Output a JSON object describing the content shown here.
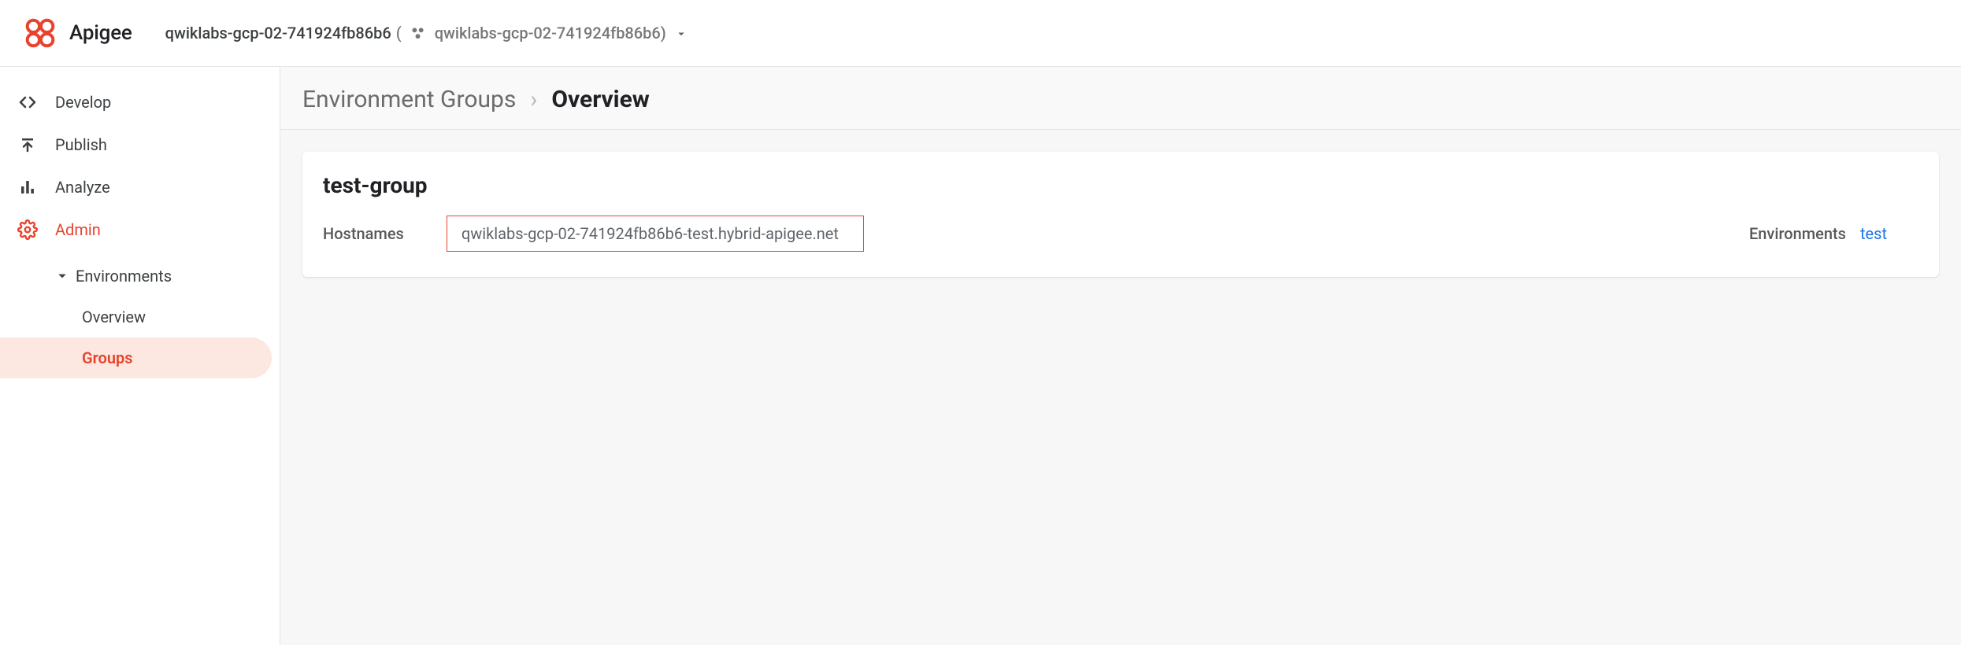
{
  "brand": {
    "name": "Apigee"
  },
  "project": {
    "name": "qwiklabs-gcp-02-741924fb86b6",
    "detail": "qwiklabs-gcp-02-741924fb86b6)"
  },
  "sidebar": {
    "items": [
      {
        "label": "Develop"
      },
      {
        "label": "Publish"
      },
      {
        "label": "Analyze"
      },
      {
        "label": "Admin"
      }
    ],
    "subgroup": {
      "header": "Environments",
      "items": [
        {
          "label": "Overview"
        },
        {
          "label": "Groups"
        }
      ]
    }
  },
  "breadcrumb": {
    "parent": "Environment Groups",
    "current": "Overview"
  },
  "card": {
    "title": "test-group",
    "hostnames_label": "Hostnames",
    "hostnames_value": "qwiklabs-gcp-02-741924fb86b6-test.hybrid-apigee.net",
    "environments_label": "Environments",
    "environments_value": "test"
  }
}
